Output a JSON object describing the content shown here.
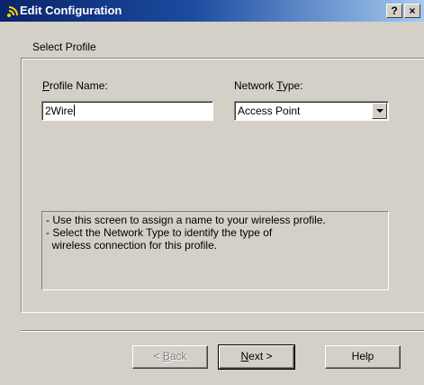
{
  "window": {
    "title": "Edit Configuration",
    "help_button": "?",
    "close_button": "×"
  },
  "group": {
    "title": "Select Profile"
  },
  "profile_name": {
    "label_mnemonic": "P",
    "label_rest": "rofile Name:",
    "value": "2Wire"
  },
  "network_type": {
    "label_prefix": "Network ",
    "label_mnemonic": "T",
    "label_rest": "ype:",
    "selected": "Access Point"
  },
  "info": {
    "lines": [
      "- Use this screen to assign a name to your wireless profile.",
      "- Select the Network Type to identify the type of",
      "  wireless connection for this profile."
    ]
  },
  "buttons": {
    "back_prefix": "< ",
    "back_mnemonic": "B",
    "back_rest": "ack",
    "next_mnemonic": "N",
    "next_rest": "ext >",
    "help": "Help"
  },
  "icons": {
    "title_icon": "wireless-signal-icon",
    "dropdown": "chevron-down-icon"
  }
}
